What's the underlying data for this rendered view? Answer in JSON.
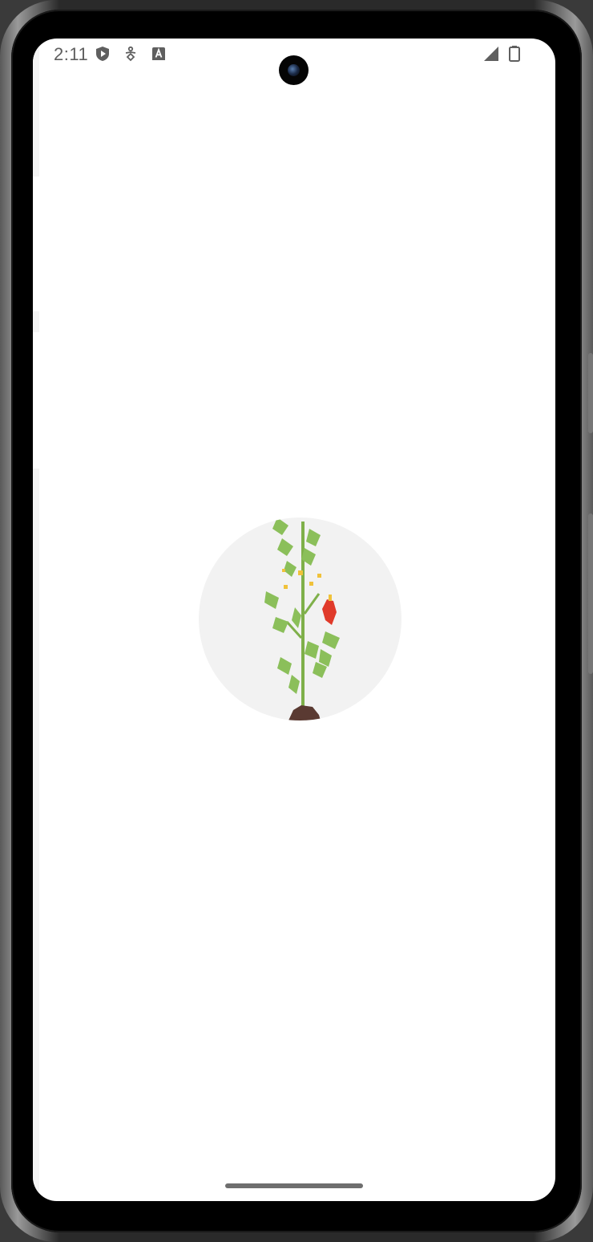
{
  "status_bar": {
    "time": "2:11",
    "left_icons": [
      "play-protect-icon",
      "accessibility-icon",
      "keyboard-a-icon"
    ],
    "right_icons": [
      "signal-icon",
      "battery-icon"
    ]
  },
  "splash": {
    "image": "plant-icon",
    "colors": {
      "circle_background": "#f2f2f2",
      "leaf": "#8bbf5a",
      "stem": "#7fb04a",
      "pepper": "#e03a2a",
      "flower": "#f0c23a",
      "soil": "#5a3a32"
    }
  }
}
